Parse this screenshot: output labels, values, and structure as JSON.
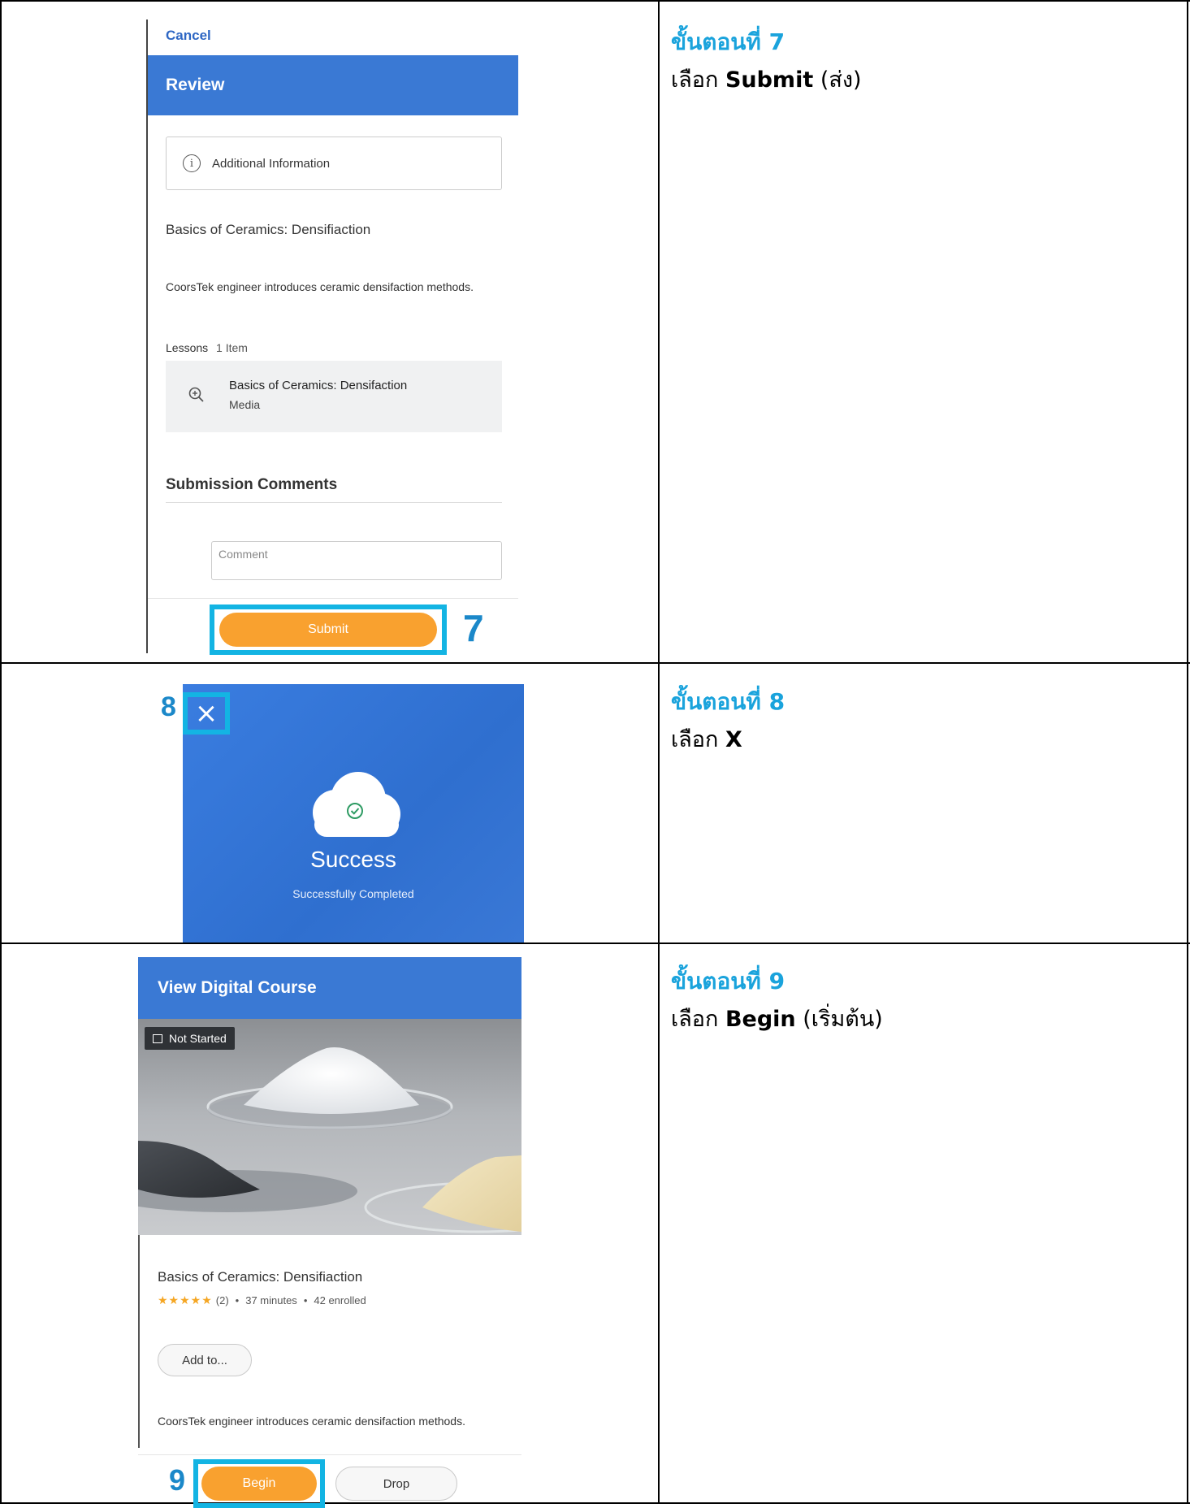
{
  "steps": [
    {
      "title": "ขั้นตอนที่ 7",
      "prefix": "เลือก",
      "bold": "Submit",
      "suffix": "(ส่ง)",
      "callout_number": "7"
    },
    {
      "title": "ขั้นตอนที่ 8",
      "prefix": "เลือก",
      "bold": "X",
      "suffix": "",
      "callout_number": "8"
    },
    {
      "title": "ขั้นตอนที่ 9",
      "prefix": "เลือก",
      "bold": "Begin",
      "suffix": "(เริ่มต้น)",
      "callout_number": "9"
    }
  ],
  "review_screen": {
    "cancel_label": "Cancel",
    "header_title": "Review",
    "additional_info_label": "Additional Information",
    "course_title": "Basics of Ceramics: Densifiaction",
    "description": "CoorsTek engineer introduces ceramic densifaction methods.",
    "lessons_label": "Lessons",
    "lessons_count": "1 Item",
    "lesson_title": "Basics of Ceramics: Densifaction",
    "lesson_type": "Media",
    "submission_comments_heading": "Submission Comments",
    "comment_placeholder": "Comment",
    "submit_label": "Submit"
  },
  "success_screen": {
    "title": "Success",
    "subtitle": "Successfully Completed",
    "close_glyph": "×"
  },
  "course_screen": {
    "header_title": "View Digital Course",
    "status_badge": "Not Started",
    "course_title": "Basics of Ceramics: Densifiaction",
    "rating_stars": 5,
    "rating_count": "(2)",
    "duration": "37 minutes",
    "enrolled": "42 enrolled",
    "separator": "•",
    "add_to_label": "Add to...",
    "description": "CoorsTek engineer introduces ceramic densifaction methods.",
    "begin_label": "Begin",
    "drop_label": "Drop"
  },
  "colors": {
    "accent_blue": "#3a79d4",
    "callout_cyan": "#13b4e3",
    "button_orange": "#f9a12f",
    "star_orange": "#f5a623",
    "thai_title": "#1aa3dc"
  }
}
